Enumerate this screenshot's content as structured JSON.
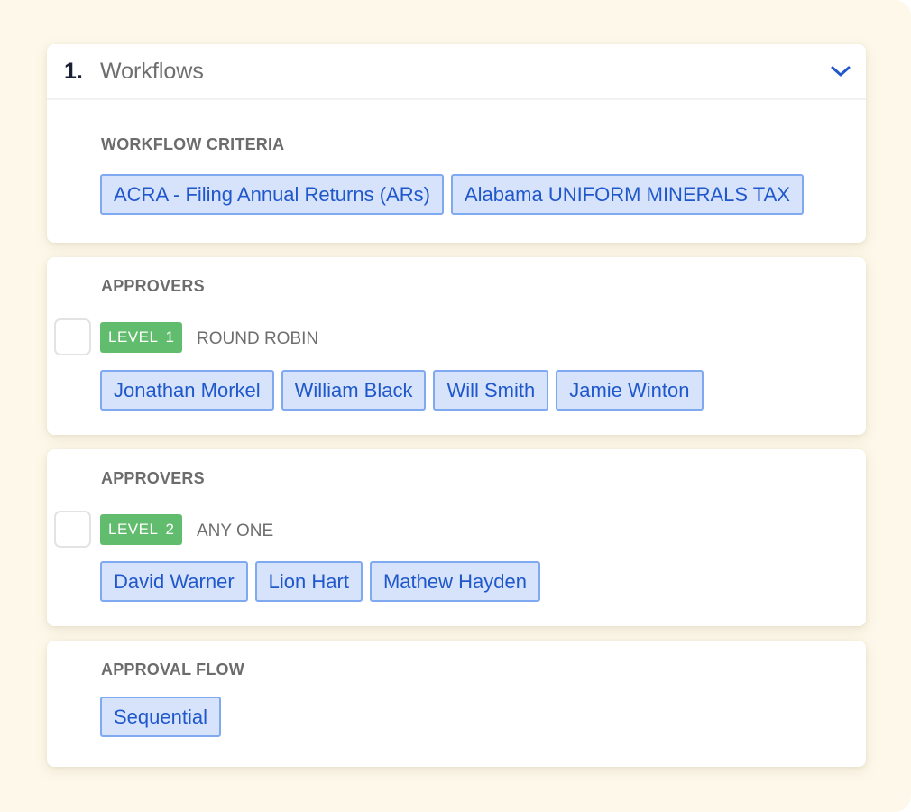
{
  "header": {
    "step_number": "1.",
    "title": "Workflows",
    "expand_icon": "chevron-down-icon"
  },
  "workflow_criteria": {
    "label": "WORKFLOW CRITERIA",
    "chips": [
      "ACRA - Filing Annual Returns (ARs)",
      "Alabama UNIFORM MINERALS TAX"
    ]
  },
  "approver_levels": [
    {
      "label": "APPROVERS",
      "level_word": "LEVEL",
      "level_number": "1",
      "mode": "ROUND ROBIN",
      "approvers": [
        "Jonathan Morkel",
        "William Black",
        "Will Smith",
        "Jamie Winton"
      ]
    },
    {
      "label": "APPROVERS",
      "level_word": "LEVEL",
      "level_number": "2",
      "mode": "ANY ONE",
      "approvers": [
        "David Warner",
        "Lion Hart",
        "Mathew Hayden"
      ]
    }
  ],
  "approval_flow": {
    "label": "APPROVAL FLOW",
    "chips": [
      "Sequential"
    ]
  },
  "colors": {
    "background": "#fdf8ea",
    "chip_bg": "#d6e3fb",
    "chip_border": "#7fa9f0",
    "chip_text": "#2058cc",
    "level_badge": "#62bc6e",
    "accent": "#2058cc"
  }
}
